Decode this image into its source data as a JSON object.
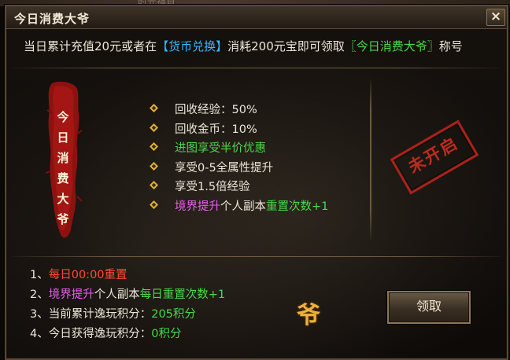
{
  "top_strip_text": "时光福首",
  "window": {
    "title": "今日消费大爷",
    "close_label": "×"
  },
  "description": {
    "part1": "当日累计充值20元或者在",
    "currency_link": "【货币兑换】",
    "part2": "消耗200元宝即可领取",
    "title_name": "〖今日消费大爷〗",
    "part3": "称号"
  },
  "banner": {
    "chars": [
      "今",
      "日",
      "消",
      "费",
      "大",
      "爷"
    ]
  },
  "benefits": [
    {
      "segments": [
        {
          "text": "回收经验：50%",
          "color": "white"
        }
      ]
    },
    {
      "segments": [
        {
          "text": "回收金币：10%",
          "color": "white"
        }
      ]
    },
    {
      "segments": [
        {
          "text": "进图享受半价优惠",
          "color": "green"
        }
      ]
    },
    {
      "segments": [
        {
          "text": "享受0-5全属性提升",
          "color": "white"
        }
      ]
    },
    {
      "segments": [
        {
          "text": "享受1.5倍经验",
          "color": "white"
        }
      ]
    },
    {
      "segments": [
        {
          "text": "境界提升",
          "color": "purple"
        },
        {
          "text": "个人副本",
          "color": "white"
        },
        {
          "text": "重置次数+1",
          "color": "green"
        }
      ]
    }
  ],
  "status_stamp": "未开启",
  "rules": [
    {
      "segments": [
        {
          "text": "1、",
          "color": "white"
        },
        {
          "text": "每日00:00重置",
          "color": "red"
        }
      ]
    },
    {
      "segments": [
        {
          "text": "2、",
          "color": "white"
        },
        {
          "text": "境界提升",
          "color": "purple"
        },
        {
          "text": "个人副本",
          "color": "white"
        },
        {
          "text": "每日重置次数+1",
          "color": "green"
        }
      ]
    },
    {
      "segments": [
        {
          "text": "3、当前累计逸玩积分：",
          "color": "white"
        },
        {
          "text": "205积分",
          "color": "green"
        }
      ]
    },
    {
      "segments": [
        {
          "text": "4、今日获得逸玩积分：",
          "color": "white"
        },
        {
          "text": "0积分",
          "color": "green"
        }
      ]
    }
  ],
  "ye_char": "爷",
  "claim_button": "领取",
  "colors": {
    "white": "#ece6d8",
    "green": "#49d94b",
    "red": "#ff4a3a",
    "purple": "#e85ef0",
    "blue": "#38b6ff",
    "gold": "#e8b23c"
  }
}
